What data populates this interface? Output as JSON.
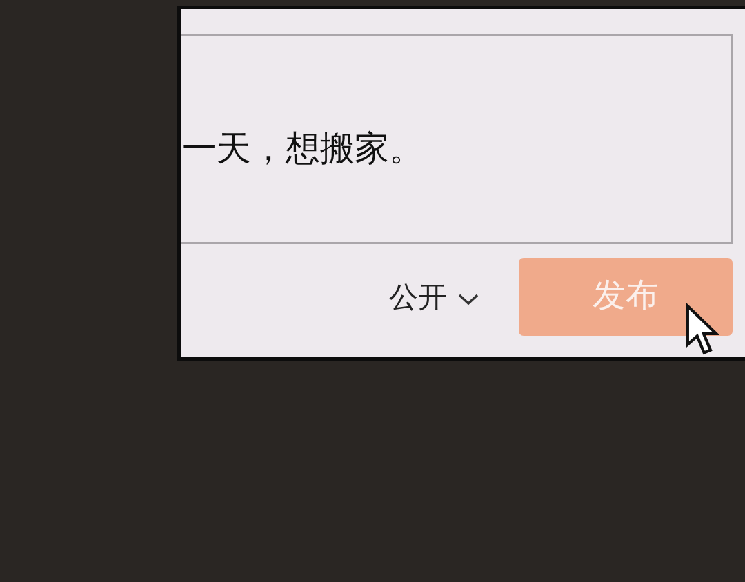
{
  "composer": {
    "value": "一天，想搬家。"
  },
  "footer": {
    "visibility": {
      "label": "公开"
    },
    "publish_button": {
      "label": "发布"
    }
  }
}
